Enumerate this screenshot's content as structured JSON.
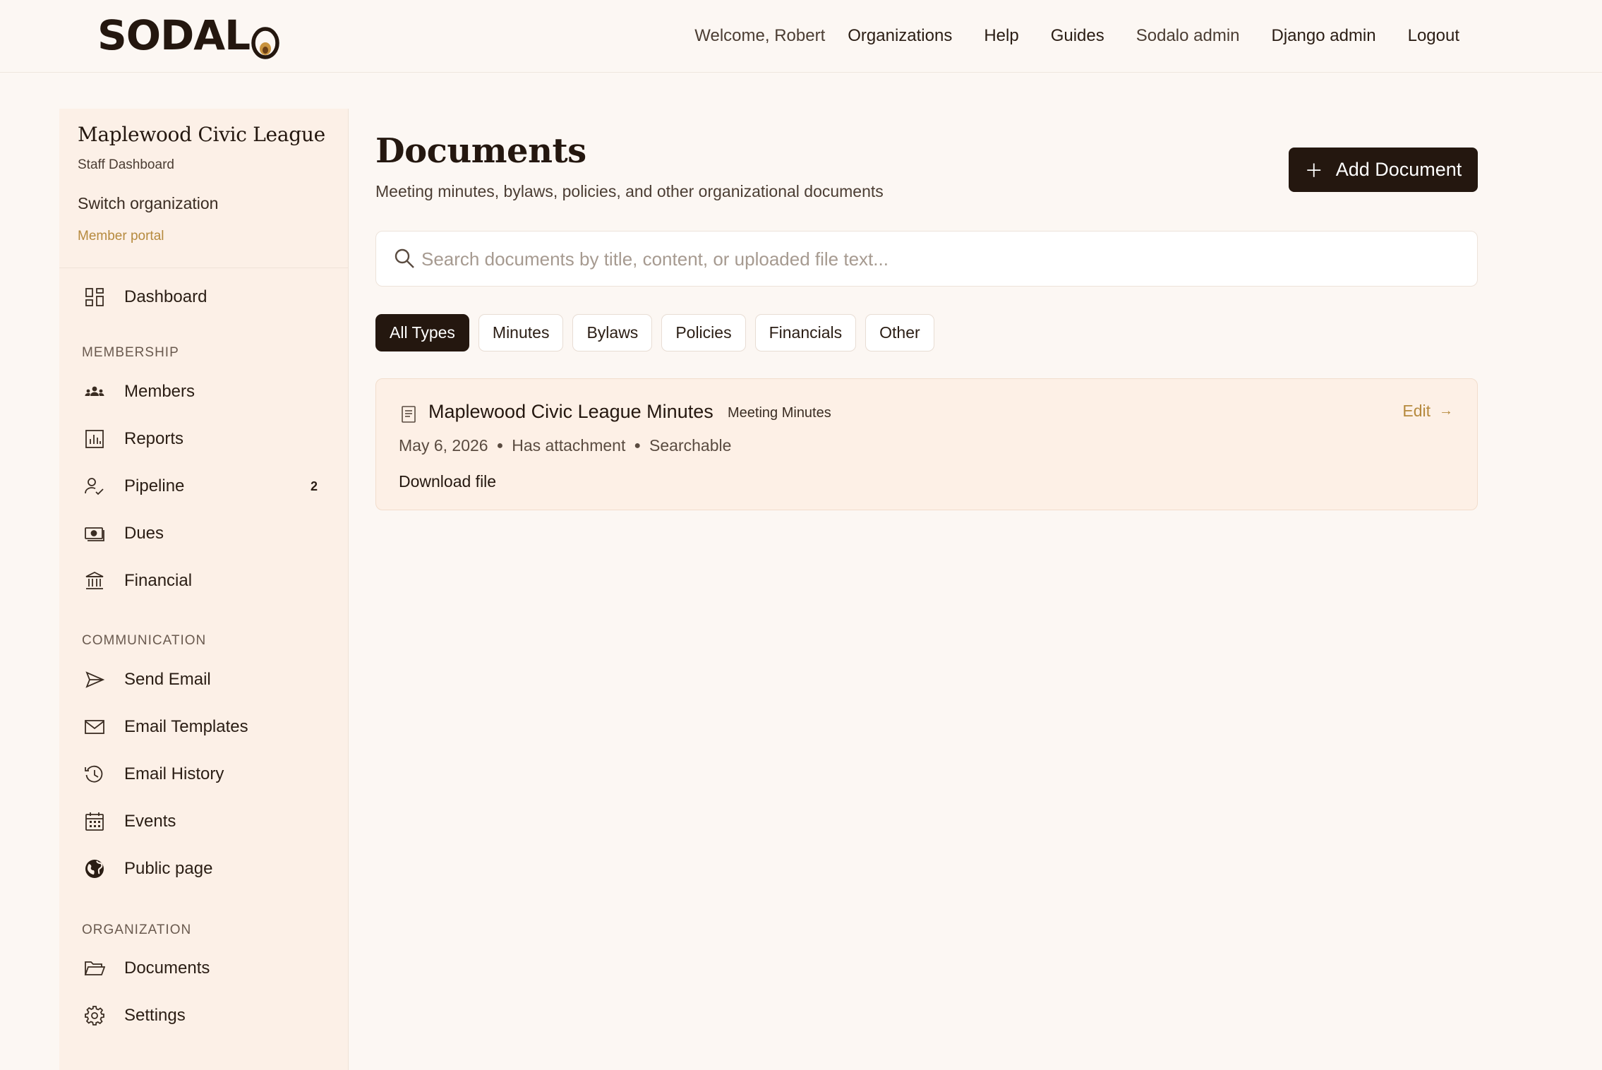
{
  "header": {
    "logo_text": "SODAL",
    "welcome": "Welcome, Robert",
    "nav": [
      {
        "label": "Organizations"
      },
      {
        "label": "Help"
      },
      {
        "label": "Guides"
      },
      {
        "label": "Sodalo admin"
      },
      {
        "label": "Django admin"
      },
      {
        "label": "Logout"
      }
    ]
  },
  "sidebar": {
    "org_name": "Maplewood Civic League",
    "org_subtitle": "Staff Dashboard",
    "switch_org": "Switch organization",
    "member_portal": "Member portal",
    "dashboard": {
      "label": "Dashboard",
      "icon": "dashboard-grid-icon"
    },
    "sections": {
      "membership": "MEMBERSHIP",
      "communication": "COMMUNICATION",
      "organization": "ORGANIZATION"
    },
    "items": {
      "members": {
        "label": "Members",
        "icon": "members-icon"
      },
      "reports": {
        "label": "Reports",
        "icon": "bar-chart-icon"
      },
      "pipeline": {
        "label": "Pipeline",
        "icon": "user-check-icon",
        "badge": "2"
      },
      "dues": {
        "label": "Dues",
        "icon": "cash-icon"
      },
      "financial": {
        "label": "Financial",
        "icon": "bank-icon"
      },
      "send_email": {
        "label": "Send Email",
        "icon": "send-icon"
      },
      "email_templates": {
        "label": "Email Templates",
        "icon": "envelope-icon"
      },
      "email_history": {
        "label": "Email History",
        "icon": "history-icon"
      },
      "events": {
        "label": "Events",
        "icon": "calendar-icon"
      },
      "public_page": {
        "label": "Public page",
        "icon": "globe-icon"
      },
      "documents": {
        "label": "Documents",
        "icon": "folder-icon"
      },
      "settings": {
        "label": "Settings",
        "icon": "gear-icon"
      }
    }
  },
  "main": {
    "title": "Documents",
    "subtitle": "Meeting minutes, bylaws, policies, and other organizational documents",
    "add_button": "Add Document",
    "search_placeholder": "Search documents by title, content, or uploaded file text...",
    "filters": [
      {
        "label": "All Types",
        "active": true
      },
      {
        "label": "Minutes"
      },
      {
        "label": "Bylaws"
      },
      {
        "label": "Policies"
      },
      {
        "label": "Financials"
      },
      {
        "label": "Other"
      }
    ],
    "documents": [
      {
        "title": "Maplewood Civic League Minutes",
        "type": "Meeting Minutes",
        "date": "May 6, 2026",
        "attachment": "Has attachment",
        "searchable": "Searchable",
        "edit": "Edit",
        "download": "Download file"
      }
    ]
  },
  "colors": {
    "background": "#fcf7f3",
    "sidebar": "#fcf0e7",
    "primary_dark": "#24170f",
    "accent_gold": "#b68a3e",
    "card": "#fdf0e6"
  }
}
